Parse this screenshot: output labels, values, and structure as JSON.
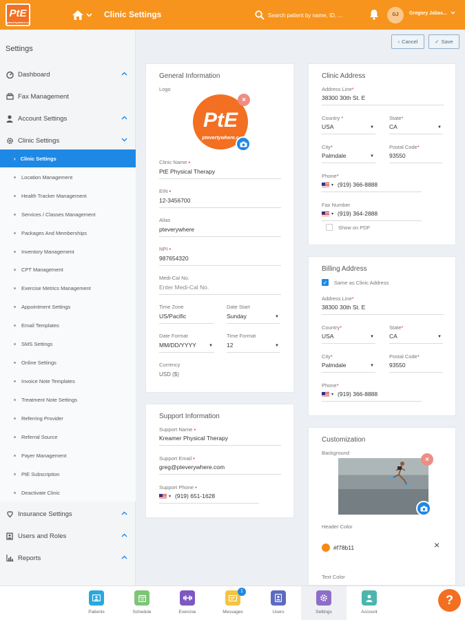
{
  "header": {
    "logo_text": "PtE",
    "logo_sub": "ptevertywhere.com",
    "page_title": "Clinic Settings",
    "search_placeholder": "Search patient by name, ID, ...",
    "user_initials": "GJ",
    "user_name": "Gregory Jabas..."
  },
  "actions": {
    "cancel": "Cancel",
    "save": "Save"
  },
  "sidebar": {
    "title": "Settings",
    "items": [
      {
        "label": "Dashboard",
        "icon": "dashboard-icon"
      },
      {
        "label": "Fax Management",
        "icon": "fax-icon"
      },
      {
        "label": "Account Settings",
        "icon": "user-icon"
      },
      {
        "label": "Clinic Settings",
        "icon": "gear-icon"
      },
      {
        "label": "Insurance Settings",
        "icon": "insurance-icon"
      },
      {
        "label": "Users and Roles",
        "icon": "users-icon"
      },
      {
        "label": "Reports",
        "icon": "chart-icon"
      }
    ],
    "subitems": [
      "Clinic Settings",
      "Location Management",
      "Health Tracker Management",
      "Services / Classes Management",
      "Packages And Memberships",
      "Inventory Management",
      "CPT Management",
      "Exercise Metrics Management",
      "Appointment Settings",
      "Email Templates",
      "SMS Settings",
      "Online Settings",
      "Invoice Note Templates",
      "Treatment Note Settings",
      "Referring Provider",
      "Referral Source",
      "Payer Management",
      "PtE Subscription",
      "Deactivate Clinic"
    ]
  },
  "general": {
    "title": "General Information",
    "logo_label": "Logo",
    "logo_text": "PtE",
    "logo_sub": "ptevertywhere.c",
    "clinic_name_label": "Clinic Name",
    "clinic_name": "PtE Physical Therapy",
    "ein_label": "EIN",
    "ein": "12-3456700",
    "alias_label": "Alias",
    "alias": "pteverywhere",
    "npi_label": "NPI",
    "npi": "987654320",
    "medical_label": "Medi-Cal No.",
    "medical_placeholder": "Enter Medi-Cal No.",
    "timezone_label": "Time Zone",
    "timezone": "US/Pacific",
    "datestart_label": "Date Start",
    "datestart": "Sunday",
    "dateformat_label": "Date Format",
    "dateformat": "MM/DD/YYYY",
    "timeformat_label": "Time Format",
    "timeformat": "12",
    "currency_label": "Currency",
    "currency": "USD ($)"
  },
  "support": {
    "title": "Support Information",
    "name_label": "Support Name",
    "name": "Kreamer Physical Therapy",
    "email_label": "Support Email",
    "email": "greg@pteverywhere.com",
    "phone_label": "Support Phone",
    "phone": "(919) 651-1628"
  },
  "clinic_address": {
    "title": "Clinic Address",
    "address_label": "Address Line",
    "address": "38300 30th St. E",
    "country_label": "Country",
    "country": "USA",
    "state_label": "State",
    "state": "CA",
    "city_label": "City",
    "city": "Palmdale",
    "postal_label": "Postal Code",
    "postal": "93550",
    "phone_label": "Phone",
    "phone": "(919) 366-8888",
    "fax_label": "Fax Number",
    "fax": "(919) 364-2888",
    "show_pdf": "Show on PDF"
  },
  "billing": {
    "title": "Billing Address",
    "same_as": "Same as Clinic Address",
    "same_checked": true,
    "address_label": "Address Line",
    "address": "38300 30th St. E",
    "country_label": "Country",
    "country": "USA",
    "state_label": "State",
    "state": "CA",
    "city_label": "City",
    "city": "Palmdale",
    "postal_label": "Postal Code",
    "postal": "93550",
    "phone_label": "Phone",
    "phone": "(919) 366-8888"
  },
  "customization": {
    "title": "Customization",
    "background_label": "Background",
    "header_color_label": "Header Color",
    "header_color": "#f78b11",
    "text_color_label": "Text Color"
  },
  "bottom_nav": [
    {
      "label": "Patients",
      "icon": "patients-icon",
      "color": "#29a8e0"
    },
    {
      "label": "Schedule",
      "icon": "calendar-icon",
      "color": "#7cc576"
    },
    {
      "label": "Exercise",
      "icon": "exercise-icon",
      "color": "#7e57c2"
    },
    {
      "label": "Messages",
      "icon": "message-icon",
      "color": "#f5c342",
      "badge": "1"
    },
    {
      "label": "Users",
      "icon": "users-icon",
      "color": "#5c6bc0"
    },
    {
      "label": "Settings",
      "icon": "settings-icon",
      "color": "#8e6ec8"
    },
    {
      "label": "Account",
      "icon": "account-icon",
      "color": "#4db6ac"
    }
  ],
  "help_label": "?"
}
